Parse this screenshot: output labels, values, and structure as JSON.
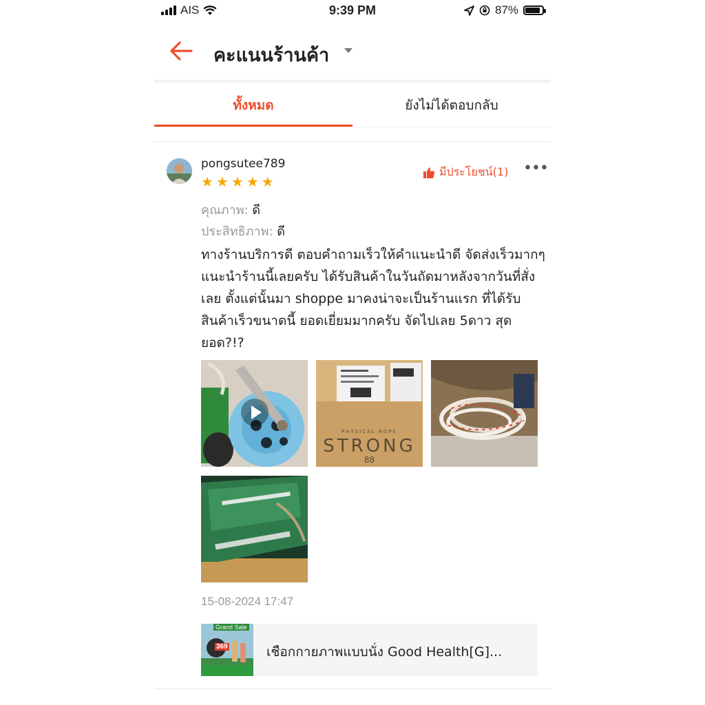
{
  "status_bar": {
    "carrier": "AIS",
    "time": "9:39 PM",
    "battery": "87%",
    "battery_level": 0.87
  },
  "header": {
    "title": "คะแนนร้านค้า",
    "back_icon": "arrow-left-icon",
    "dropdown_icon": "caret-down-icon"
  },
  "tabs": [
    {
      "label": "ทั้งหมด",
      "active": true
    },
    {
      "label": "ยังไม่ได้ตอบกลับ",
      "active": false
    }
  ],
  "review": {
    "username": "pongsutee789",
    "rating": 5,
    "helpful_label": "มีประโยชน์(1)",
    "quality_label": "คุณภาพ:",
    "quality_value": "ดี",
    "efficiency_label": "ประสิทธิภาพ:",
    "efficiency_value": "ดี",
    "comment": "ทางร้านบริการดี ตอบคำถามเร็วให้คำแนะนำดี จัดส่งเร็วมากๆ แนะนำร้านนี้เลยครับ ได้รับสินค้าในวันถัดมาหลังจากวันที่สั่งเลย ตั้งแต่นั้นมา shoppe มาคงน่าจะเป็นร้านแรก ที่ได้รับสินค้าเร็วขนาดนี้ ยอดเยี่ยมมากครับ จัดไปเลย 5ดาว สุดยอด?!?",
    "media": [
      {
        "type": "video",
        "icon": "play-icon"
      },
      {
        "type": "image",
        "box_text": "STRONG",
        "box_subtext": "88",
        "box_top": "PHYSICAL ROPE"
      },
      {
        "type": "image"
      },
      {
        "type": "image"
      }
    ],
    "date": "15-08-2024 17:47",
    "product": {
      "name": "เชือกกายภาพแบบนั่ง Good Health[G]...",
      "badge": "Grand Sale",
      "price_badge": "369"
    }
  },
  "colors": {
    "accent": "#ee4d2d",
    "star": "#f6a700",
    "muted": "#999999"
  }
}
